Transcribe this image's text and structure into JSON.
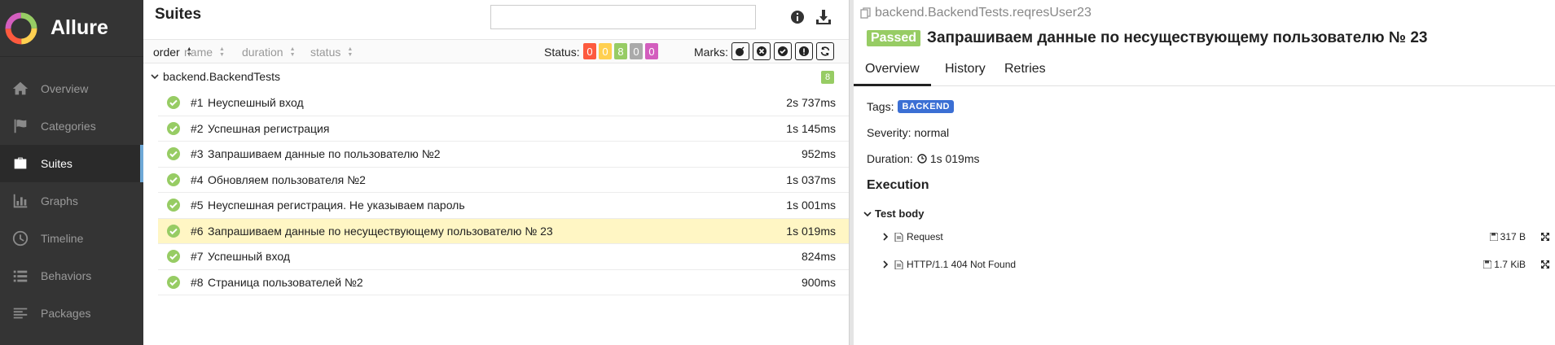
{
  "brand": {
    "name": "Allure"
  },
  "sidebar": {
    "items": [
      {
        "label": "Overview",
        "icon": "home-icon"
      },
      {
        "label": "Categories",
        "icon": "flag-icon"
      },
      {
        "label": "Suites",
        "icon": "briefcase-icon",
        "active": true
      },
      {
        "label": "Graphs",
        "icon": "bar-chart-icon"
      },
      {
        "label": "Timeline",
        "icon": "clock-icon"
      },
      {
        "label": "Behaviors",
        "icon": "list-icon"
      },
      {
        "label": "Packages",
        "icon": "align-left-icon"
      }
    ]
  },
  "suites": {
    "title": "Suites",
    "search": {
      "value": "",
      "placeholder": ""
    },
    "sort": {
      "order": "order",
      "name": "name",
      "duration": "duration",
      "status": "status"
    },
    "status_label": "Status:",
    "status_counts": [
      {
        "value": "0",
        "color": "#fd5a3e"
      },
      {
        "value": "0",
        "color": "#ffd050"
      },
      {
        "value": "8",
        "color": "#97cc64"
      },
      {
        "value": "0",
        "color": "#aaaaaa"
      },
      {
        "value": "0",
        "color": "#d35ebe"
      }
    ],
    "marks_label": "Marks:",
    "group": {
      "name": "backend.BackendTests",
      "count": "8"
    },
    "tests": [
      {
        "num": "#1",
        "name": "Неуспешный вход",
        "duration": "2s 737ms"
      },
      {
        "num": "#2",
        "name": "Успешная регистрация",
        "duration": "1s 145ms"
      },
      {
        "num": "#3",
        "name": "Запрашиваем данные по пользователю №2",
        "duration": "952ms"
      },
      {
        "num": "#4",
        "name": "Обновляем пользователя №2",
        "duration": "1s 037ms"
      },
      {
        "num": "#5",
        "name": "Неуспешная регистрация. Не указываем пароль",
        "duration": "1s 001ms"
      },
      {
        "num": "#6",
        "name": "Запрашиваем данные по несуществующему пользователю № 23",
        "duration": "1s 019ms",
        "selected": true
      },
      {
        "num": "#7",
        "name": "Успешный вход",
        "duration": "824ms"
      },
      {
        "num": "#8",
        "name": "Страница пользователей №2",
        "duration": "900ms"
      }
    ]
  },
  "detail": {
    "breadcrumb": "backend.BackendTests.reqresUser23",
    "status": "Passed",
    "title": "Запрашиваем данные по несуществующему пользователю № 23",
    "tabs": [
      "Overview",
      "History",
      "Retries"
    ],
    "tags_label": "Tags:",
    "tag": "BACKEND",
    "severity_text": "Severity: normal",
    "duration_label": "Duration:",
    "duration_value": "1s 019ms",
    "execution_title": "Execution",
    "step_title": "Test body",
    "attachments": [
      {
        "name": "Request",
        "size": "317 B"
      },
      {
        "name": "HTTP/1.1 404 Not Found",
        "size": "1.7 KiB"
      }
    ]
  }
}
